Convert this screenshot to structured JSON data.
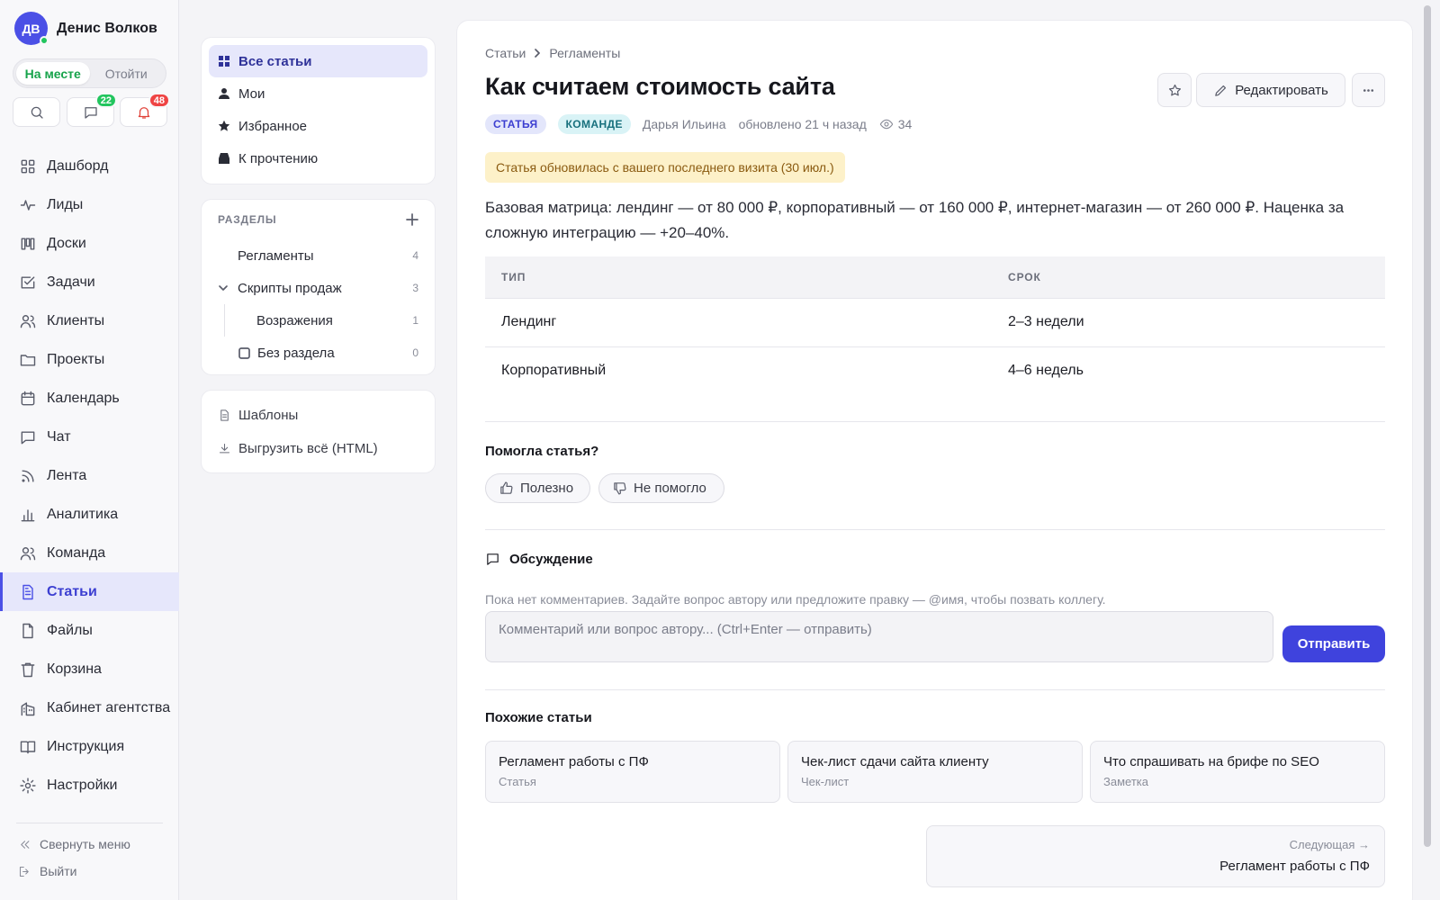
{
  "user": {
    "initials": "ДВ",
    "name": "Денис Волков"
  },
  "presence": {
    "active": "На месте",
    "away": "Отойти"
  },
  "quick": {
    "messages_count": "22",
    "notifications_count": "48"
  },
  "nav": {
    "items": [
      {
        "label": "Дашборд",
        "icon": "grid-icon"
      },
      {
        "label": "Лиды",
        "icon": "pulse-icon"
      },
      {
        "label": "Доски",
        "icon": "kanban-icon"
      },
      {
        "label": "Задачи",
        "icon": "checkbox-icon"
      },
      {
        "label": "Клиенты",
        "icon": "users-icon"
      },
      {
        "label": "Проекты",
        "icon": "folder-icon"
      },
      {
        "label": "Календарь",
        "icon": "calendar-icon"
      },
      {
        "label": "Чат",
        "icon": "chat-icon"
      },
      {
        "label": "Лента",
        "icon": "rss-icon"
      },
      {
        "label": "Аналитика",
        "icon": "bar-chart-icon"
      },
      {
        "label": "Команда",
        "icon": "team-icon"
      },
      {
        "label": "Статьи",
        "icon": "document-icon",
        "active": true
      },
      {
        "label": "Файлы",
        "icon": "file-icon"
      },
      {
        "label": "Корзина",
        "icon": "trash-icon"
      },
      {
        "label": "Кабинет агентства",
        "icon": "building-icon"
      },
      {
        "label": "Инструкция",
        "icon": "book-icon"
      },
      {
        "label": "Настройки",
        "icon": "gear-icon"
      }
    ],
    "collapse": "Свернуть меню",
    "logout": "Выйти"
  },
  "filters": {
    "all": "Все статьи",
    "mine": "Мои",
    "favorites": "Избранное",
    "to_read": "К прочтению"
  },
  "sections": {
    "title": "РАЗДЕЛЫ",
    "items": [
      {
        "label": "Регламенты",
        "count": "4"
      },
      {
        "label": "Скрипты продаж",
        "count": "3"
      },
      {
        "label": "Возражения",
        "count": "1"
      },
      {
        "label": "Без раздела",
        "count": "0"
      }
    ]
  },
  "tools": {
    "templates": "Шаблоны",
    "export": "Выгрузить всё (HTML)"
  },
  "article": {
    "breadcrumb": [
      "Статьи",
      "Регламенты"
    ],
    "title": "Как считаем стоимость сайта",
    "edit_label": "Редактировать",
    "tag_type": "СТАТЬЯ",
    "tag_scope": "КОМАНДЕ",
    "author": "Дарья Ильина",
    "updated": "обновлено 21 ч назад",
    "views": "34",
    "notice": "Статья обновилась с вашего последнего визита (30 июл.)",
    "body": "Базовая матрица: лендинг — от 80 000 ₽, корпоративный — от 160 000 ₽, интернет-магазин — от 260 000 ₽. Наценка за сложную интеграцию — +20–40%.",
    "table": {
      "headers": [
        "ТИП",
        "СРОК"
      ],
      "rows": [
        [
          "Лендинг",
          "2–3 недели"
        ],
        [
          "Корпоративный",
          "4–6 недель"
        ]
      ]
    },
    "feedback": {
      "question": "Помогла статья?",
      "yes": "Полезно",
      "no": "Не помогло"
    },
    "discussion": {
      "title": "Обсуждение",
      "hint": "Пока нет комментариев. Задайте вопрос автору или предложите правку — @имя, чтобы позвать коллегу.",
      "placeholder": "Комментарий или вопрос автору... (Ctrl+Enter — отправить)",
      "send": "Отправить"
    },
    "similar": {
      "title": "Похожие статьи",
      "items": [
        {
          "title": "Регламент работы с ПФ",
          "kind": "Статья"
        },
        {
          "title": "Чек-лист сдачи сайта клиенту",
          "kind": "Чек-лист"
        },
        {
          "title": "Что спрашивать на брифе по SEO",
          "kind": "Заметка"
        }
      ]
    },
    "next": {
      "label": "Следующая →",
      "title": "Регламент работы с ПФ"
    }
  },
  "colors": {
    "accent": "#4b50e6",
    "online": "#22c55e",
    "badge_green": "#22c55e",
    "badge_red": "#ef4444"
  }
}
